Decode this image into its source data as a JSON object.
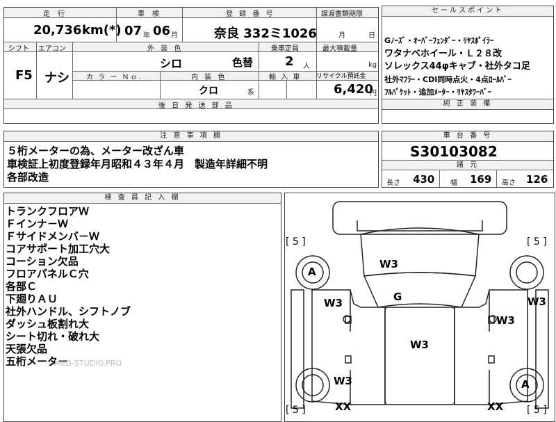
{
  "header": {
    "mileage_label": "走 行",
    "inspection_label": "車 検",
    "registration_label": "登 録 番 号",
    "transfer_label": "譲渡書類期限",
    "sales_points_label": "セールスポイント",
    "shift_label": "シフト",
    "aircon_label": "エアコン",
    "exterior_color_label": "外 装 色",
    "capacity_label": "乗車定員",
    "max_load_label": "最大積載量",
    "color_no_label": "カ ラ ー Ｎｏ.",
    "interior_color_label": "内 装 色",
    "import_label": "輸 入 車",
    "recycle_label": "リサイクル預託金",
    "later_parts_label": "後 日 発 送 部 品",
    "genuine_label": "純 正 装 備",
    "notes_label": "注 意 事 項 欄",
    "chassis_label": "車 台 番 号",
    "dimensions_label": "諸 元",
    "inspector_label": "検 査 員 記 入 欄"
  },
  "vehicle": {
    "mileage": "20,736",
    "mileage_unit": "km(*)",
    "inspection_year": "07",
    "year_unit": "年",
    "inspection_month": "06",
    "month_unit": "月",
    "registration": "奈良 332ミ1026",
    "transfer_month_unit": "月",
    "transfer_day_unit": "日",
    "shift": "F5",
    "aircon": "ナシ",
    "exterior_color": "シロ",
    "color_change": "色替",
    "capacity": "2",
    "capacity_unit": "人",
    "load_unit": "kg",
    "interior_color": "クロ",
    "interior_suffix": "系",
    "recycle_fee": "6,420",
    "recycle_unit": "円",
    "chassis_number": "S30103082",
    "length_label": "長さ",
    "length": "430",
    "width_label": "幅",
    "width": "169",
    "height_label": "高さ",
    "height": "126"
  },
  "sales_points": [
    "Gﾉｰｽﾞ・ｵｰﾊﾞｰﾌｪﾝﾀﾞｰ・ﾘﾔｽﾎﾟｲﾗｰ",
    "ワタナベホイール・Ｌ２８改",
    "ソレックス44φキャブ・社外タコ足",
    "社外ﾏﾌﾗｰ・CDI同時点火・4点ﾛｰﾙﾊﾞｰ",
    "ﾌﾙﾊﾞｹｯﾄ・追加ﾒｰﾀｰ・ﾘﾔｽﾀﾜｰﾊﾞｰ"
  ],
  "notes": [
    "５桁メーターの為、メーター改ざん車",
    "車検証上初度登録年月昭和４３年４月　製造年詳細不明",
    "各部改造"
  ],
  "inspector_notes": [
    "トランクフロアＷ",
    "Ｆインナ－Ｗ",
    "Ｆサイドメンバ－Ｗ",
    "コアサポート加工穴大",
    "コーション欠品",
    "フロアパネルＣ穴",
    "各部Ｃ",
    "下廻りＡＵ",
    "社外ハンドル、シフトノブ",
    "ダッシュ板割れ大",
    "シート切れ・破れ大",
    "天張欠品",
    "五桁メーター"
  ],
  "watermark": "MED-STUDIO.PRO",
  "diagram": {
    "bracket_value": "5",
    "labels": {
      "front_left_wheel": "A",
      "rear_right_wheel": "A",
      "hood": "W3",
      "windshield": "G",
      "left_front_door": "W3",
      "right_front_fender": "W3",
      "right_door": "W3",
      "roof": "W3",
      "left_rear": "W3",
      "left_rear_bottom": "XX",
      "right_rear_bottom": "XX"
    }
  }
}
